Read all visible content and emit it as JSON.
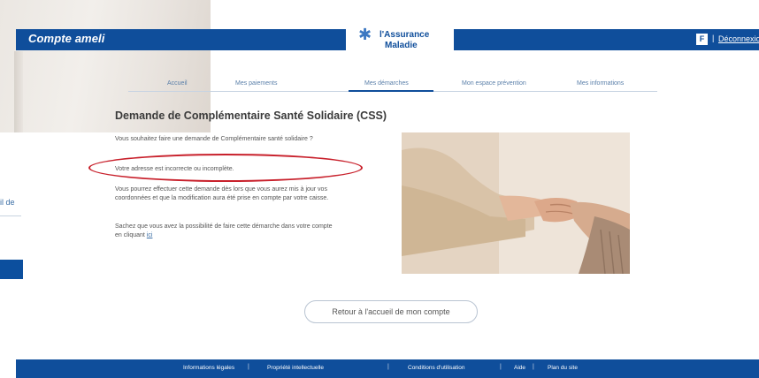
{
  "header": {
    "brand": "Compte ameli",
    "logo_line1": "l'Assurance",
    "logo_line2": "Maladie",
    "lang_icon_label": "fr",
    "separator": "|",
    "logout_label": "Déconnexion"
  },
  "background": {
    "partial_link_text": "il de"
  },
  "nav": {
    "tabs": [
      {
        "label": "Accueil",
        "active": false
      },
      {
        "label": "Mes paiements",
        "active": false
      },
      {
        "label": "Mes démarches",
        "active": true
      },
      {
        "label": "Mon espace prévention",
        "active": false
      },
      {
        "label": "Mes informations",
        "active": false
      }
    ]
  },
  "main": {
    "title": "Demande de Complémentaire Santé Solidaire (CSS)",
    "p1": "Vous souhaitez faire une demande de Complémentaire santé solidaire ?",
    "p2": "Votre adresse est incorrecte ou incomplète.",
    "p3": "Vous pourrez effectuer cette demande dès lors que vous aurez mis à jour vos coordonnées et que la modification aura été prise en compte par votre caisse.",
    "p4_text": "Sachez que vous avez la possibilité de faire cette démarche dans votre compte en cliquant",
    "p4_link": "ici",
    "return_button": "Retour à l'accueil de mon compte"
  },
  "footer": {
    "links": [
      "Informations légales",
      "Propriété intellectuelle",
      "Conditions d'utilisation",
      "Aide",
      "Plan du site"
    ],
    "separator": "|"
  },
  "colors": {
    "primary": "#0f4e9b",
    "highlight": "#c8202b",
    "link": "#3b6ea5"
  }
}
